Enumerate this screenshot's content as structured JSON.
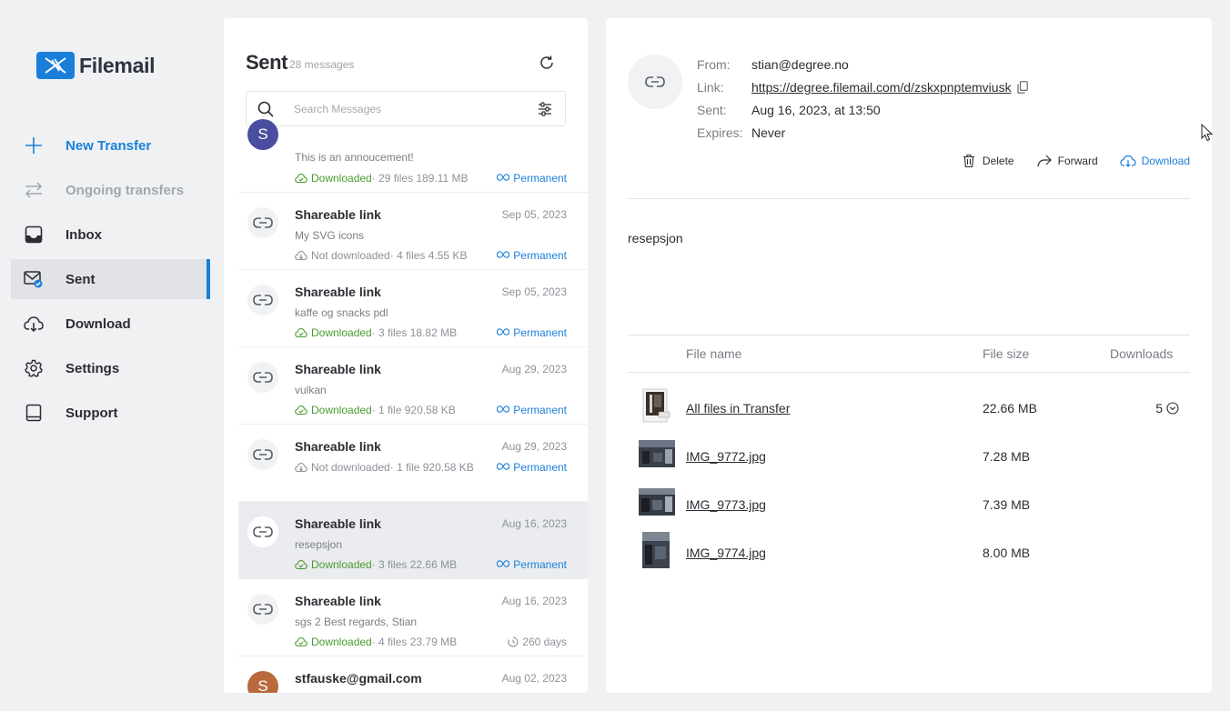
{
  "brand": {
    "name": "Filemail",
    "color": "#1b7fd9"
  },
  "sidebar": {
    "items": [
      {
        "label": "New Transfer",
        "icon": "plus-icon"
      },
      {
        "label": "Ongoing transfers",
        "icon": "arrows-swap-icon"
      },
      {
        "label": "Inbox",
        "icon": "inbox-icon"
      },
      {
        "label": "Sent",
        "icon": "sent-mail-icon"
      },
      {
        "label": "Download",
        "icon": "cloud-download-icon"
      },
      {
        "label": "Settings",
        "icon": "gear-icon"
      },
      {
        "label": "Support",
        "icon": "support-book-icon"
      }
    ]
  },
  "list": {
    "title": "Sent",
    "count": "28 messages",
    "search_placeholder": "Search Messages",
    "messages": [
      {
        "title": "",
        "date": "",
        "subtitle": "This is an annoucement!",
        "status": "Downloaded",
        "meta": " · 29 files  189.11 MB",
        "expiry": "Permanent",
        "avatar": "S"
      },
      {
        "title": "Shareable link",
        "date": "Sep 05, 2023",
        "subtitle": "My SVG icons",
        "status": "Not downloaded",
        "meta": " · 4 files  4.55 KB",
        "expiry": "Permanent"
      },
      {
        "title": "Shareable link",
        "date": "Sep 05, 2023",
        "subtitle": "kaffe og snacks pdl",
        "status": "Downloaded",
        "meta": " · 3 files  18.82 MB",
        "expiry": "Permanent"
      },
      {
        "title": "Shareable link",
        "date": "Aug 29, 2023",
        "subtitle": "vulkan",
        "status": "Downloaded",
        "meta": " · 1 file  920.58 KB",
        "expiry": "Permanent"
      },
      {
        "title": "Shareable link",
        "date": "Aug 29, 2023",
        "subtitle": "",
        "status": "Not downloaded",
        "meta": " · 1 file  920.58 KB",
        "expiry": "Permanent"
      },
      {
        "title": "Shareable link",
        "date": "Aug 16, 2023",
        "subtitle": "resepsjon",
        "status": "Downloaded",
        "meta": " · 3 files  22.66 MB",
        "expiry": "Permanent"
      },
      {
        "title": "Shareable link",
        "date": "Aug 16, 2023",
        "subtitle": "sgs 2 Best regards, Stian",
        "status": "Downloaded",
        "meta": " · 4 files  23.79 MB",
        "expiry": "260 days"
      },
      {
        "title": "stfauske@gmail.com",
        "date": "Aug 02, 2023",
        "subtitle": "",
        "status": "",
        "meta": "",
        "expiry": "",
        "avatar": "S"
      }
    ]
  },
  "detail": {
    "from_label": "From:",
    "from": "stian@degree.no",
    "link_label": "Link:",
    "link": "https://degree.filemail.com/d/zskxpnptemviusk",
    "sent_label": "Sent:",
    "sent": "Aug 16, 2023, at 13:50",
    "expires_label": "Expires:",
    "expires": "Never",
    "actions": {
      "delete": "Delete",
      "forward": "Forward",
      "download": "Download"
    },
    "message": "resepsjon",
    "table": {
      "headers": {
        "name": "File name",
        "size": "File size",
        "downloads": "Downloads"
      },
      "rows": [
        {
          "name": "All files in Transfer",
          "size": "22.66 MB",
          "downloads": "5"
        },
        {
          "name": "IMG_9772.jpg",
          "size": "7.28 MB",
          "downloads": ""
        },
        {
          "name": "IMG_9773.jpg",
          "size": "7.39 MB",
          "downloads": ""
        },
        {
          "name": "IMG_9774.jpg",
          "size": "8.00 MB",
          "downloads": ""
        }
      ]
    }
  }
}
